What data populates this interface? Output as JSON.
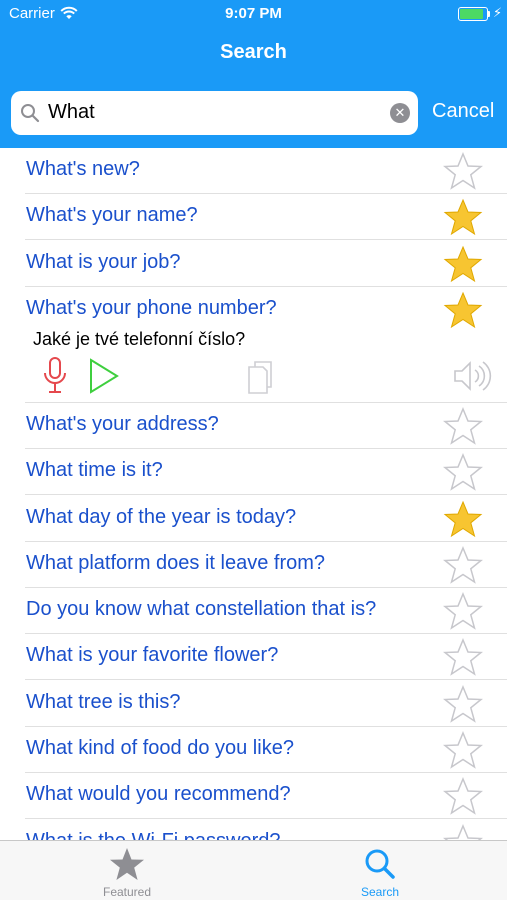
{
  "status_bar": {
    "carrier": "Carrier",
    "time": "9:07 PM",
    "battery_level": 0.9
  },
  "nav": {
    "title": "Search"
  },
  "search": {
    "value": "What",
    "cancel_label": "Cancel"
  },
  "colors": {
    "accent": "#1a9af7",
    "link": "#1a50cc",
    "star_fill": "#f7c531"
  },
  "rows": [
    {
      "text": "What's new?",
      "starred": false
    },
    {
      "text": "What's your name?",
      "starred": true
    },
    {
      "text": "What is your job?",
      "starred": true
    },
    {
      "text": "What's your phone number?",
      "starred": true
    },
    {
      "text": "What's your address?",
      "starred": false
    },
    {
      "text": "What time is it?",
      "starred": false
    },
    {
      "text": "What day of the year is today?",
      "starred": true
    },
    {
      "text": "What platform does it leave from?",
      "starred": false
    },
    {
      "text": "Do you know what constellation that is?",
      "starred": false
    },
    {
      "text": "What is your favorite flower?",
      "starred": false
    },
    {
      "text": "What tree is this?",
      "starred": false
    },
    {
      "text": "What kind of food do you like?",
      "starred": false
    },
    {
      "text": "What would you recommend?",
      "starred": false
    },
    {
      "text": "What is the Wi-Fi password?",
      "starred": false
    }
  ],
  "expanded": {
    "translation": "Jaké je tvé telefonní číslo?",
    "icons": [
      "microphone-icon",
      "play-icon",
      "copy-icon",
      "speaker-icon"
    ]
  },
  "tabbar": {
    "tabs": [
      {
        "label": "Featured",
        "icon": "star-icon",
        "active": false
      },
      {
        "label": "Search",
        "icon": "search-icon",
        "active": true
      }
    ]
  }
}
